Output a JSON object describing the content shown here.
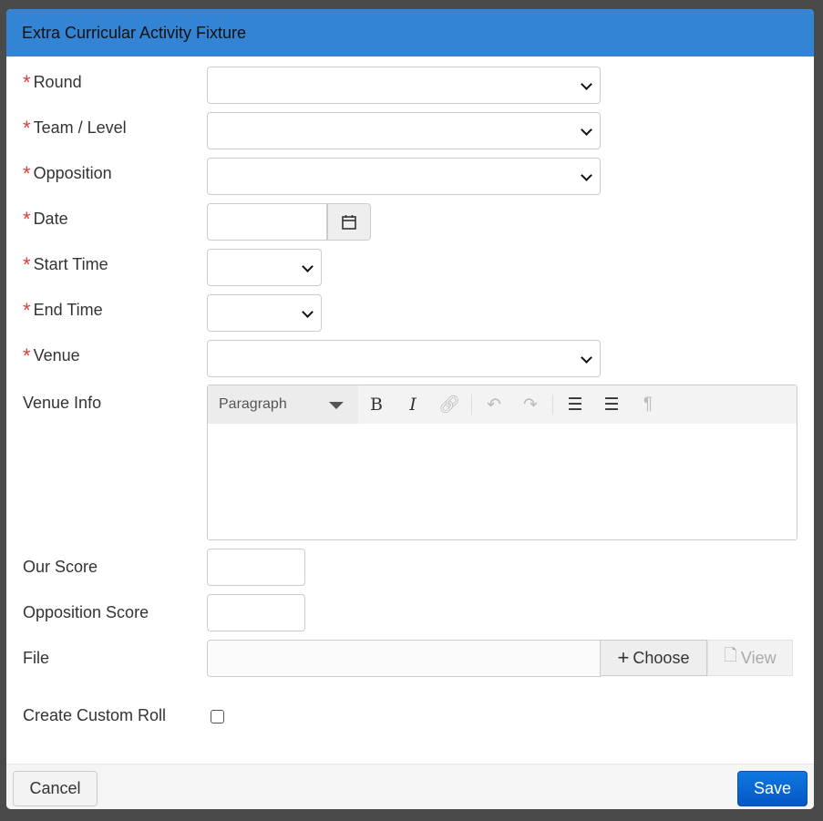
{
  "dialog": {
    "title": "Extra Curricular Activity Fixture"
  },
  "fields": {
    "round": {
      "label": "Round",
      "required": true,
      "value": ""
    },
    "team": {
      "label": "Team / Level",
      "required": true,
      "value": ""
    },
    "opposition": {
      "label": "Opposition",
      "required": true,
      "value": ""
    },
    "date": {
      "label": "Date",
      "required": true,
      "value": ""
    },
    "start_time": {
      "label": "Start Time",
      "required": true,
      "value": ""
    },
    "end_time": {
      "label": "End Time",
      "required": true,
      "value": ""
    },
    "venue": {
      "label": "Venue",
      "required": true,
      "value": ""
    },
    "venue_info": {
      "label": "Venue Info",
      "format": "Paragraph",
      "value": ""
    },
    "our_score": {
      "label": "Our Score",
      "value": ""
    },
    "opp_score": {
      "label": "Opposition Score",
      "value": ""
    },
    "file": {
      "label": "File",
      "choose": "Choose",
      "view": "View"
    },
    "custom_roll": {
      "label": "Create Custom Roll",
      "checked": false
    }
  },
  "required_mark": "*",
  "footer": {
    "cancel": "Cancel",
    "save": "Save"
  },
  "colors": {
    "header": "#3384d5",
    "save": "#0a67d0",
    "required": "#d9403a"
  }
}
